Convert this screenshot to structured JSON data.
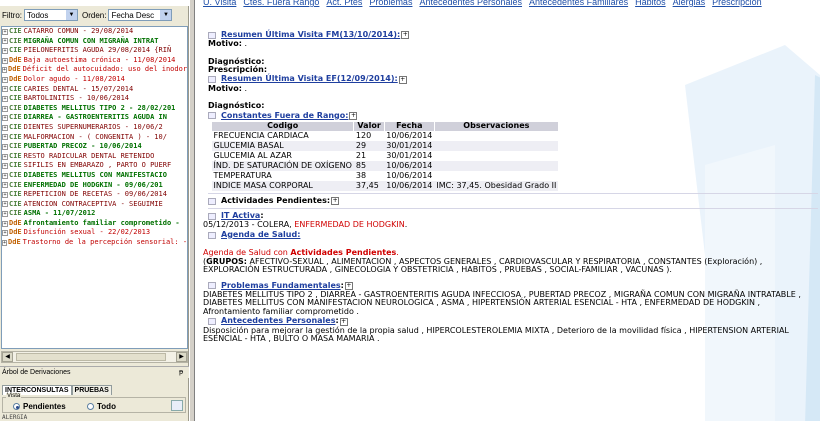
{
  "filters": {
    "filtro_label": "Filtro:",
    "filtro_value": "Todos",
    "orden_label": "Orden:",
    "orden_value": "Fecha Desc"
  },
  "tree": [
    {
      "tag": "CIE",
      "text": "CATARRO COMUN  - 29/08/2014",
      "style": "normal"
    },
    {
      "tag": "CIE",
      "text": "MIGRAÑA COMUN CON MIGRAÑA INTRAT",
      "style": "bold"
    },
    {
      "tag": "CIE",
      "text": "PIELONEFRITIS AGUDA 29/08/2014 {RIÑ",
      "style": "normal"
    },
    {
      "tag": "DdE",
      "text": "Baja autoestima crónica  - 11/08/2014",
      "style": "normal"
    },
    {
      "tag": "DdE",
      "text": "Déficit del autocuidado: uso del inodoro",
      "style": "normal"
    },
    {
      "tag": "DdE",
      "text": "Dolor agudo  - 11/08/2014",
      "style": "normal"
    },
    {
      "tag": "CIE",
      "text": "CARIES DENTAL  - 15/07/2014",
      "style": "normal"
    },
    {
      "tag": "CIE",
      "text": "BARTOLINITIS  - 10/06/2014",
      "style": "normal"
    },
    {
      "tag": "CIE",
      "text": "DIABETES MELLITUS TIPO 2  - 28/02/201",
      "style": "bold"
    },
    {
      "tag": "CIE",
      "text": "DIARREA - GASTROENTERITIS AGUDA IN",
      "style": "bold"
    },
    {
      "tag": "CIE",
      "text": "DIENTES SUPERNUMERARIOS  - 10/06/2",
      "style": "normal"
    },
    {
      "tag": "CIE",
      "text": "MALFORMACION  - ( CONGENITA ) - 10/",
      "style": "normal"
    },
    {
      "tag": "CIE",
      "text": "PUBERTAD PRECOZ  - 10/06/2014",
      "style": "bold"
    },
    {
      "tag": "CIE",
      "text": "RESTO RADICULAR DENTAL RETENIDO",
      "style": "normal"
    },
    {
      "tag": "CIE",
      "text": "SIFILIS EN EMBARAZO , PARTO O PUERF",
      "style": "normal"
    },
    {
      "tag": "CIE",
      "text": "DIABETES MELLITUS CON MANIFESTACIO",
      "style": "bold"
    },
    {
      "tag": "CIE",
      "text": "ENFERMEDAD DE HODGKIN  - 09/06/201",
      "style": "bold"
    },
    {
      "tag": "CIE",
      "text": "REPETICION DE RECETAS  - 09/06/2014",
      "style": "normal"
    },
    {
      "tag": "CIE",
      "text": "ATENCION CONTRACEPTIVA - SEGUIMIE",
      "style": "normal"
    },
    {
      "tag": "CIE",
      "text": "ASMA  - 11/07/2012",
      "style": "bold"
    },
    {
      "tag": "DdE",
      "text": "Afrontamiento familiar comprometido  - ",
      "style": "bold"
    },
    {
      "tag": "DdE",
      "text": "Disfunción sexual  - 22/02/2013",
      "style": "normal"
    },
    {
      "tag": "DdE",
      "text": "Trastorno de la percepción sensorial: - (",
      "style": "normal"
    }
  ],
  "deriv": {
    "title": "Árbol de Derivaciones",
    "pin": "📌",
    "tab1": "INTERCONSULTAS",
    "tab2": "PRUEBAS",
    "legend": "Vista",
    "radio1": "Pendientes",
    "radio2": "Todo",
    "last": "ALERGIA"
  },
  "nav": [
    "U. Visita",
    "Ctes. Fuera Rango",
    "Act. Ptes",
    "Problemas",
    "Antecedentes Personales",
    "Antecedentes Familiares",
    "Habitos",
    "Alergias",
    "Prescripcion"
  ],
  "content": {
    "resumen_fm": "Resumen Última Visita FM(13/10/2014):",
    "motivo_label": "Motivo:",
    "motivo_val": " .",
    "diag_label": "Diagnóstico:",
    "presc_label": "Prescripción:",
    "resumen_ef": "Resumen Última Visita EF(12/09/2014):",
    "motivo_label2": "Motivo:",
    "motivo_val2": " .",
    "diag_label2": "Diagnóstico:",
    "constantes": "Constantes Fuera de Rango:",
    "table_headers": [
      "Codigo",
      "Valor",
      "Fecha",
      "Observaciones"
    ],
    "table_rows": [
      [
        "FRECUENCIA CARDIACA",
        "120",
        "10/06/2014",
        ""
      ],
      [
        "GLUCEMIA BASAL",
        "29",
        "30/01/2014",
        ""
      ],
      [
        "GLUCEMIA AL AZAR",
        "21",
        "30/01/2014",
        ""
      ],
      [
        "ÍND. DE SATURACIÓN DE OXÍGENO",
        "85",
        "10/06/2014",
        ""
      ],
      [
        "TEMPERATURA",
        "38",
        "10/06/2014",
        ""
      ],
      [
        "INDICE MASA CORPORAL",
        "37,45",
        "10/06/2014",
        "IMC: 37,45. Obesidad Grado II"
      ]
    ],
    "actividades": "Actividades Pendientes:",
    "it_activa": "IT Activa",
    "it_text": "05/12/2013 - COLERA, ",
    "it_text_red": "ENFERMEDAD DE HODGKIN",
    "it_text_end": ".",
    "agenda": "Agenda de Salud:",
    "agenda_text_a": "Agenda de Salud con ",
    "agenda_text_b": "Actividades Pendientes",
    "agenda_text_c": ".",
    "grupos_open": "(",
    "grupos_label": "GRUPOS:",
    "grupos_text": " AFECTIVO-SEXUAL , ALIMENTACION , ASPECTOS GENERALES , CARDIOVASCULAR Y RESPIRATORIA , CONSTANTES (Exploración) , EXPLORACIÓN ESTRUCTURADA , GINECOLOGIA Y OBSTETRICIA , HABITOS , PRUEBAS , SOCIAL-FAMILIAR , VACUNAS ).",
    "problemas": "Problemas Fundamentales",
    "problemas_text": "DIABETES MELLITUS TIPO 2 , DIARREA - GASTROENTERITIS AGUDA INFECCIOSA , PUBERTAD PRECOZ , MIGRAÑA COMUN CON MIGRAÑA INTRATABLE , DIABETES MELLITUS CON MANIFESTACION NEUROLOGICA , ASMA , HIPERTENSIÓN ARTERIAL ESENCIAL - HTA , ENFERMEDAD DE HODGKIN , Afrontamiento familiar comprometido .",
    "antecedentes": "Antecedentes Personales",
    "antecedentes_text": "Disposición para mejorar la gestión de la propia salud , HIPERCOLESTEROLEMIA MIXTA , Deterioro de la movilidad física , HIPERTENSION ARTERIAL ESENCIAL - HTA , BULTO O MASA MAMARIA ."
  },
  "colors": {
    "link": "#1f3f9f",
    "alert": "#d00000",
    "cie_bold": "#007000"
  }
}
